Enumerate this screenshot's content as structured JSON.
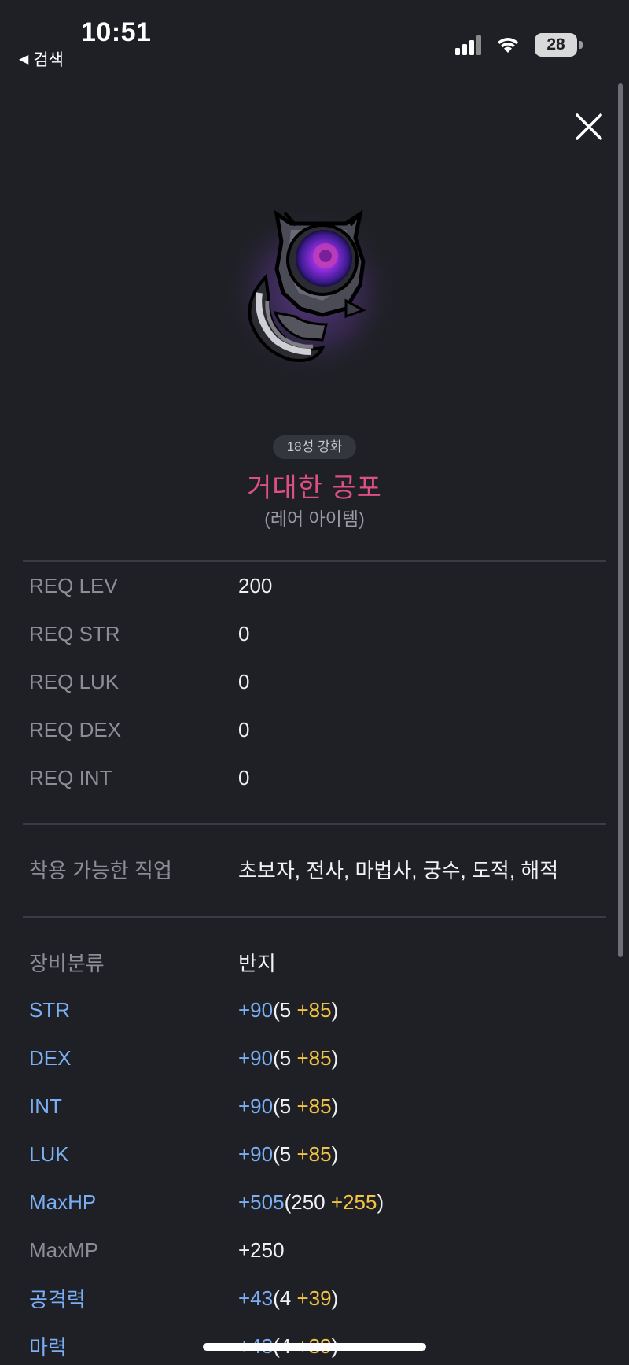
{
  "status_bar": {
    "time": "10:51",
    "back_label": "검색",
    "battery": "28"
  },
  "item": {
    "enhance_badge": "18성 강화",
    "name": "거대한 공포",
    "grade": "(레어 아이템)"
  },
  "requirements": [
    {
      "label": "REQ LEV",
      "value": "200"
    },
    {
      "label": "REQ STR",
      "value": "0"
    },
    {
      "label": "REQ LUK",
      "value": "0"
    },
    {
      "label": "REQ DEX",
      "value": "0"
    },
    {
      "label": "REQ INT",
      "value": "0"
    }
  ],
  "jobs": {
    "label": "착용 가능한 직업",
    "value": "초보자, 전사, 마법사, 궁수, 도적, 해적"
  },
  "category": {
    "label": "장비분류",
    "value": "반지"
  },
  "stats": [
    {
      "label": "STR",
      "total": "+90",
      "base": "5",
      "bonus": "+85"
    },
    {
      "label": "DEX",
      "total": "+90",
      "base": "5",
      "bonus": "+85"
    },
    {
      "label": "INT",
      "total": "+90",
      "base": "5",
      "bonus": "+85"
    },
    {
      "label": "LUK",
      "total": "+90",
      "base": "5",
      "bonus": "+85"
    },
    {
      "label": "MaxHP",
      "total": "+505",
      "base": "250",
      "bonus": "+255"
    }
  ],
  "maxmp": {
    "label": "MaxMP",
    "value": "+250"
  },
  "attack_stats": [
    {
      "label": "공격력",
      "total": "+43",
      "base": "4",
      "bonus": "+39"
    },
    {
      "label": "마력",
      "total": "+43",
      "base": "4",
      "bonus": "+39"
    }
  ],
  "colors": {
    "item_name": "#de4f86",
    "stat_blue": "#7aaef5",
    "bonus_gold": "#f2c443",
    "background": "#1f2026"
  }
}
